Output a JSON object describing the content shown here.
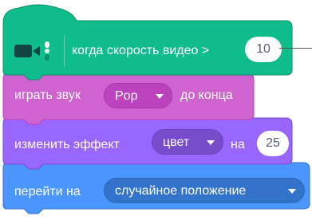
{
  "hat_block": {
    "category": "video-sensing",
    "color": "#0fbd8c",
    "icon": "video-camera-icon",
    "label": "когда скорость видео >",
    "threshold_value": "10"
  },
  "sound_block": {
    "category": "sound",
    "color": "#cf63cf",
    "label_prefix": "играть звук",
    "sound_menu_value": "Pop",
    "label_suffix": "до конца"
  },
  "effect_block": {
    "category": "looks",
    "color": "#9966ff",
    "label_prefix": "изменить эффект",
    "effect_menu_value": "цвет",
    "label_middle": "на",
    "amount_value": "25"
  },
  "motion_block": {
    "category": "motion",
    "color": "#4c97ff",
    "label_prefix": "перейти на",
    "target_menu_value": "случайное положение"
  }
}
